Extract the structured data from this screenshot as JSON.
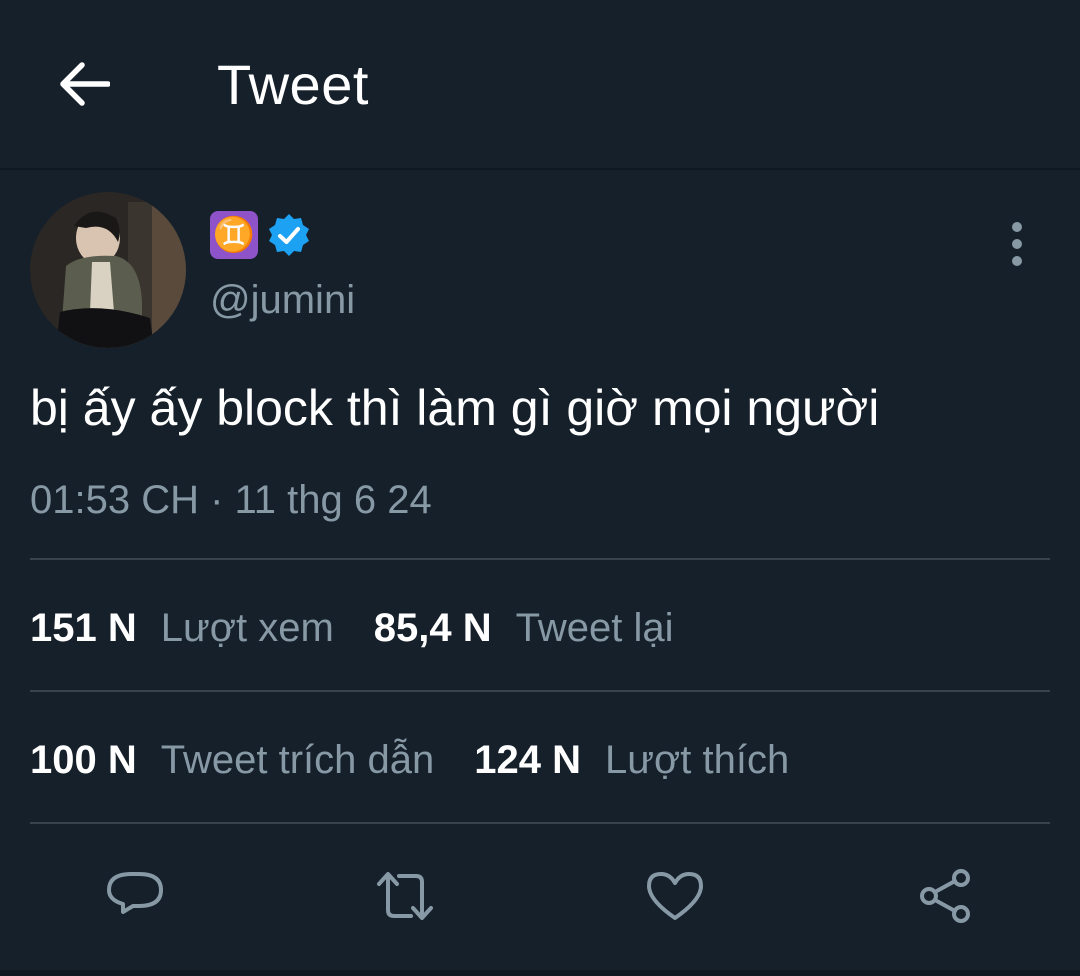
{
  "header": {
    "title": "Tweet",
    "back_icon": "arrow-left-icon"
  },
  "user": {
    "display_name_emoji": "♊",
    "verified_icon": "verified-badge-icon",
    "handle": "@jumini"
  },
  "tweet": {
    "text": "bị ấy ấy block thì làm gì giờ mọi người",
    "timestamp": "01:53 CH · 11 thg 6 24"
  },
  "stats": {
    "views_num": "151 N",
    "views_label": "Lượt xem",
    "retweets_num": "85,4 N",
    "retweets_label": "Tweet lại",
    "quotes_num": "100 N",
    "quotes_label": "Tweet trích dẫn",
    "likes_num": "124 N",
    "likes_label": "Lượt thích"
  },
  "actions": [
    "reply-icon",
    "retweet-icon",
    "like-icon",
    "share-icon"
  ],
  "colors": {
    "background": "#15202b",
    "secondary_text": "#8899a6",
    "divider": "#38444d",
    "verified": "#1da1f2",
    "gemini_badge": "#8e52c9"
  }
}
